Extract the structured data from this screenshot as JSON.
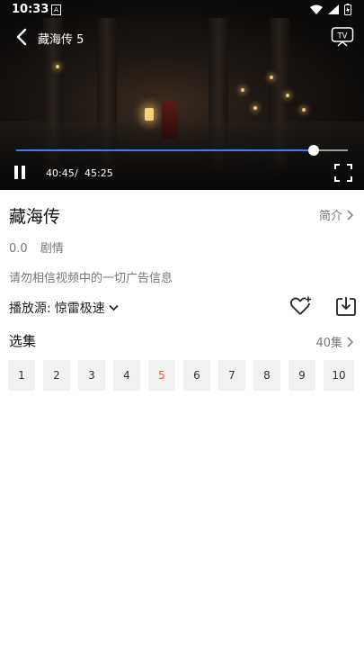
{
  "status_bar": {
    "time": "10:33",
    "notification_icon": "A"
  },
  "player": {
    "title": "藏海传 5",
    "current_time": "40:45",
    "separator": "/",
    "duration": "45:25",
    "progress_fraction": 0.897,
    "progress_color": "#3d7bf0"
  },
  "info": {
    "title": "藏海传",
    "intro_label": "简介",
    "rating": "0.0",
    "genre": "剧情",
    "ad_warning": "请勿相信视频中的一切广告信息",
    "source_label": "播放源:",
    "source_value": "惊雷极速"
  },
  "episodes": {
    "label": "选集",
    "count_label": "40集",
    "active_index": 4,
    "active_color": "#e8574a",
    "items": [
      "1",
      "2",
      "3",
      "4",
      "5",
      "6",
      "7",
      "8",
      "9",
      "10"
    ]
  }
}
